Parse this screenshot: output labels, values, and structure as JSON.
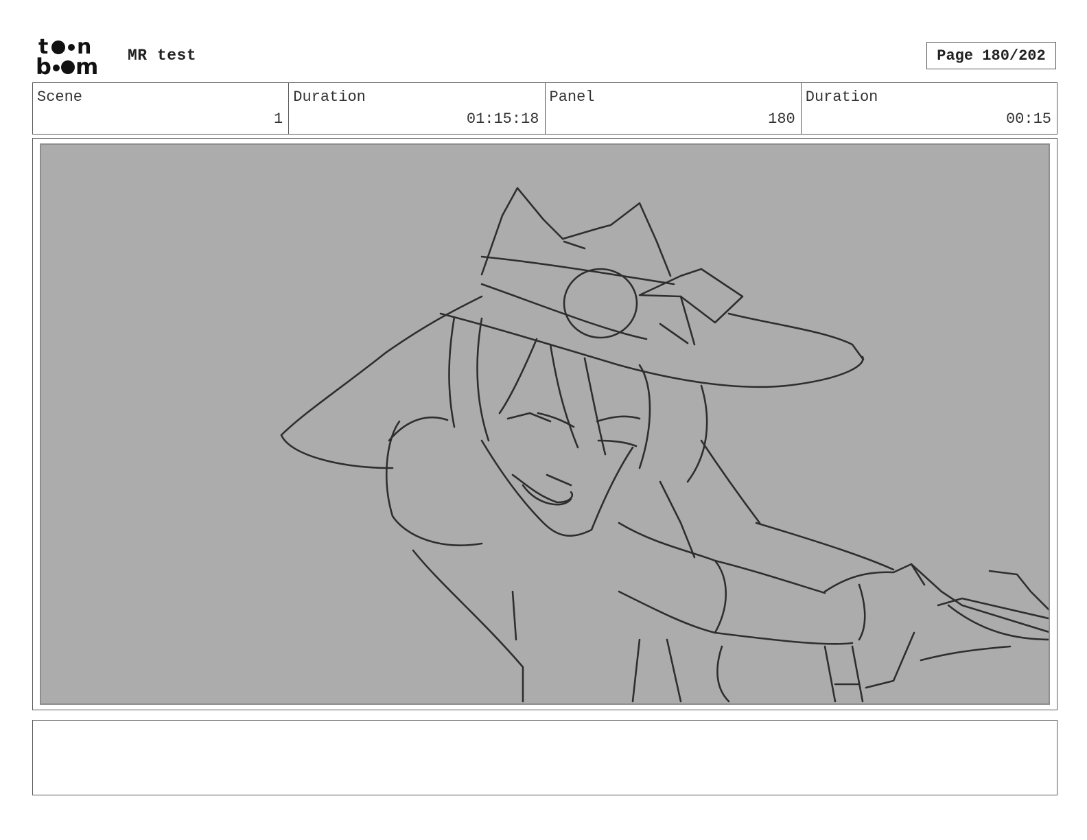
{
  "header": {
    "logo_text": "toon boom",
    "project_title": "MR test",
    "page_label": "Page 180/202"
  },
  "info": {
    "scene_label": "Scene",
    "scene_value": "1",
    "scene_duration_label": "Duration",
    "scene_duration_value": "01:15:18",
    "panel_label": "Panel",
    "panel_value": "180",
    "panel_duration_label": "Duration",
    "panel_duration_value": "00:15"
  },
  "panel": {
    "background_color": "#acacac",
    "sketch_color": "#2e2e2e",
    "image": "pencil-sketch-witch-with-sword"
  },
  "notes": {
    "text": ""
  }
}
